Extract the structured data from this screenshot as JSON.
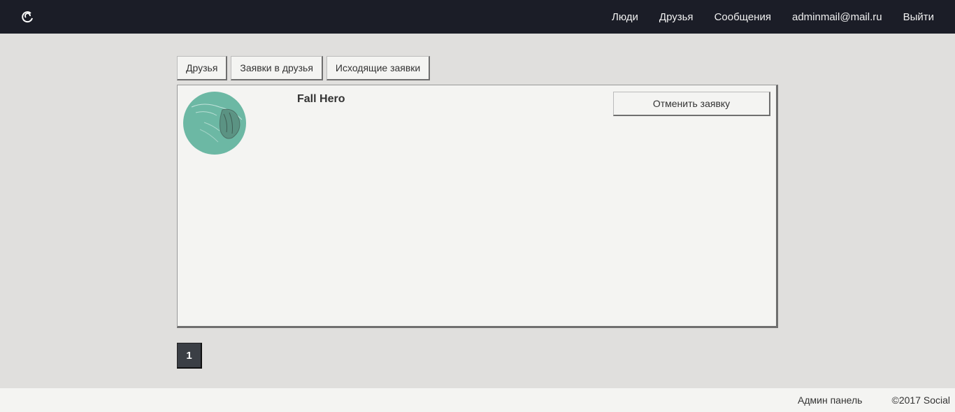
{
  "navbar": {
    "logo_icon": "swirl-logo-icon",
    "links": [
      "Люди",
      "Друзья",
      "Сообщения",
      "adminmail@mail.ru",
      "Выйти"
    ]
  },
  "tabs": [
    "Друзья",
    "Заявки в друзья",
    "Исходящие заявки"
  ],
  "request": {
    "avatar_icon": "user-avatar",
    "name": "Fall Hero",
    "cancel_label": "Отменить заявку"
  },
  "pagination": {
    "current_page": "1"
  },
  "footer": {
    "admin_link": "Админ панель",
    "copyright": "©2017 Social"
  },
  "colors": {
    "navbar_bg": "#1b1d27",
    "page_bg": "#e0dfdd",
    "panel_bg": "#f4f4f2",
    "avatar_bg": "#6cb8a4",
    "page_button_bg": "#3b3f45"
  }
}
